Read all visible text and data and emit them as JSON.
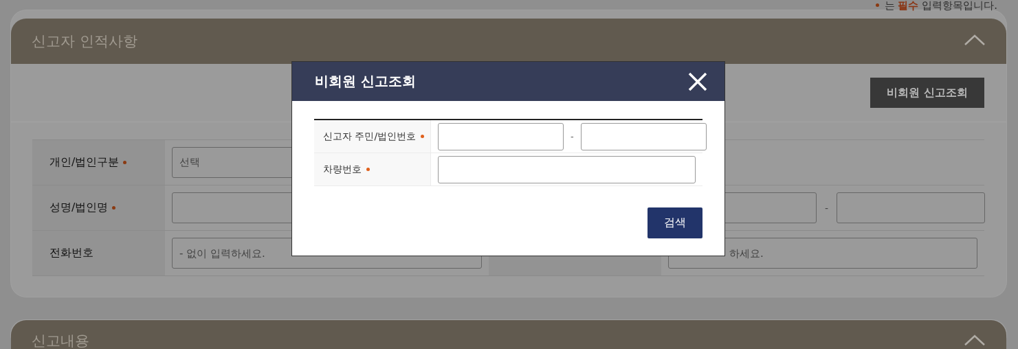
{
  "notice": "는 **필수** 입력항목입니다.",
  "sections": [
    {
      "title": "신고자 인적사항",
      "expanded": true,
      "action": "비회원 신고조회",
      "rows": [
        {
          "label": "개인/법인구분",
          "required": true,
          "fields": [
            {
              "kind": "select",
              "value": "선택"
            }
          ],
          "right_fields": []
        },
        {
          "label": "성명/법인명",
          "required": true,
          "fields": [
            {
              "kind": "text"
            }
          ],
          "right_fields": [
            {
              "kind": "text"
            },
            {
              "kind": "separator",
              "text": "-"
            },
            {
              "kind": "text"
            }
          ]
        },
        {
          "label": "전화번호",
          "required": false,
          "fields": [
            {
              "kind": "text",
              "placeholder": "- 없이 입력하세요."
            }
          ],
          "right_fields": [
            {
              "kind": "text",
              "placeholder": "하세요."
            }
          ]
        }
      ]
    },
    {
      "title": "신고내용",
      "expanded": true
    }
  ],
  "modal": {
    "title": "비회원 신고조회",
    "rows": [
      {
        "label": "신고자 주민/법인번호",
        "required": true,
        "fields": [
          {
            "kind": "text"
          },
          {
            "kind": "separator",
            "text": "-"
          },
          {
            "kind": "text"
          }
        ]
      },
      {
        "label": "차량번호",
        "required": true,
        "fields": [
          {
            "kind": "text"
          }
        ]
      }
    ],
    "button": "검색"
  }
}
